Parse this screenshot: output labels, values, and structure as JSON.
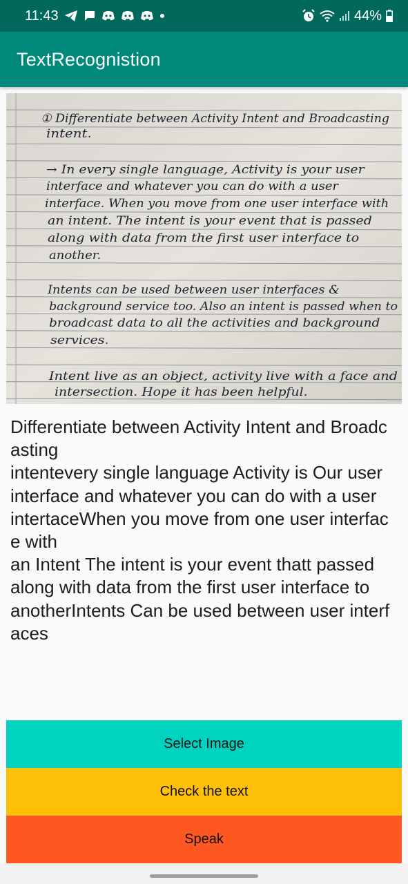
{
  "status_bar": {
    "time": "11:43",
    "battery": "44%",
    "left_icons": [
      "telegram-icon",
      "message-icon",
      "discord-icon",
      "discord-icon",
      "discord-icon",
      "dot-icon"
    ],
    "right_icons": [
      "alarm-icon",
      "wifi-icon",
      "signal-icon",
      "battery-icon"
    ]
  },
  "app_bar": {
    "title": "TextRecognistion",
    "color": "#00897b",
    "status_color": "#00695c"
  },
  "image": {
    "lines": [
      "① Differentiate between Activity Intent and Broadcasting",
      "intent.",
      "→ In every single language, Activity is your user",
      "interface and whatever you can do with a user",
      "interface. When you move from one user interface with",
      "an intent. The intent is your event that is passed",
      "along with data from the first user interface to",
      "another.",
      "Intents can be used between user interfaces &",
      "background service too. Also an intent is passed when to",
      "broadcast data to all the activities and background",
      "services.",
      "Intent live as an object, activity live with a face and",
      "intersection. Hope it has been helpful."
    ]
  },
  "result": {
    "text": "Differentiate between Activity Intent and Broadcasting\nintentevery single language Activity is Our user\ninterface and whatever you can do with a user\nintertaceWhen you move from one user interface with\nan Intent The intent is your event thatt passed\nalong with data from the first user interface to\nanotherIntents Can be used between user interfaces"
  },
  "buttons": {
    "select_image": {
      "label": "Select Image",
      "color": "#00d4c0"
    },
    "check_text": {
      "label": "Check the text",
      "color": "#ffc107"
    },
    "speak": {
      "label": "Speak",
      "color": "#ff5722"
    }
  }
}
